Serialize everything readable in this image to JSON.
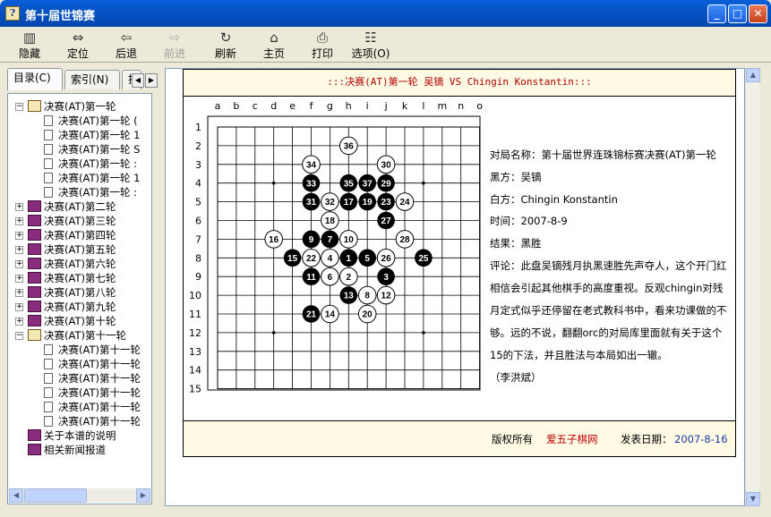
{
  "window": {
    "title": "第十届世锦赛",
    "icon": "help-book-icon",
    "min": "_",
    "max": "□",
    "close": "✕"
  },
  "toolbar": [
    {
      "label": "隐藏",
      "icon": "hide-icon",
      "glyph": "▥",
      "enabled": true
    },
    {
      "label": "定位",
      "icon": "locate-icon",
      "glyph": "⇔",
      "enabled": true
    },
    {
      "label": "后退",
      "icon": "back-arrow-icon",
      "glyph": "⇦",
      "enabled": true
    },
    {
      "label": "前进",
      "icon": "forward-arrow-icon",
      "glyph": "⇨",
      "enabled": false
    },
    {
      "label": "刷新",
      "icon": "refresh-icon",
      "glyph": "↻",
      "enabled": true
    },
    {
      "label": "主页",
      "icon": "home-icon",
      "glyph": "⌂",
      "enabled": true
    },
    {
      "label": "打印",
      "icon": "print-icon",
      "glyph": "⎙",
      "enabled": true
    },
    {
      "label": "选项(O)",
      "icon": "options-icon",
      "glyph": "☷",
      "enabled": true
    }
  ],
  "tabs": [
    {
      "label": "目录(C)"
    },
    {
      "label": "索引(N)"
    },
    {
      "label": "搜"
    }
  ],
  "tree": [
    {
      "label": "决赛(AT)第一轮",
      "open": true,
      "children": [
        "决赛(AT)第一轮 (",
        "决赛(AT)第一轮 1",
        "决赛(AT)第一轮 S",
        "决赛(AT)第一轮 :",
        "决赛(AT)第一轮 1",
        "决赛(AT)第一轮 :"
      ]
    },
    {
      "label": "决赛(AT)第二轮",
      "open": false,
      "children": []
    },
    {
      "label": "决赛(AT)第三轮",
      "open": false,
      "children": []
    },
    {
      "label": "决赛(AT)第四轮",
      "open": false,
      "children": []
    },
    {
      "label": "决赛(AT)第五轮",
      "open": false,
      "children": []
    },
    {
      "label": "决赛(AT)第六轮",
      "open": false,
      "children": []
    },
    {
      "label": "决赛(AT)第七轮",
      "open": false,
      "children": []
    },
    {
      "label": "决赛(AT)第八轮",
      "open": false,
      "children": []
    },
    {
      "label": "决赛(AT)第九轮",
      "open": false,
      "children": []
    },
    {
      "label": "决赛(AT)第十轮",
      "open": false,
      "children": []
    },
    {
      "label": "决赛(AT)第十一轮",
      "open": true,
      "children": [
        "决赛(AT)第十一轮",
        "决赛(AT)第十一轮",
        "决赛(AT)第十一轮",
        "决赛(AT)第十一轮",
        "决赛(AT)第十一轮",
        "决赛(AT)第十一轮"
      ]
    },
    {
      "label": "关于本谱的说明",
      "open": false,
      "leaf": true,
      "children": []
    },
    {
      "label": "相关新闻报道",
      "open": false,
      "leaf": true,
      "children": []
    }
  ],
  "page": {
    "header": ":::决赛(AT)第一轮 吴镝 VS Chingin Konstantin:::",
    "info": {
      "name": "对局名称：第十届世界连珠锦标赛决赛(AT)第一轮",
      "black": "黑方：吴镝",
      "white": "白方：Chingin Konstantin",
      "time": "时间：2007-8-9",
      "result": "结果：黑胜",
      "comment": "评论：此盘吴镝残月执黑速胜先声夺人，这个开门红相信会引起其他棋手的高度重视。反观chingin对残月定式似乎还停留在老式教科书中，看来功课做的不够。远的不说，翻翻orc的对局库里面就有关于这个15的下法，并且胜法与本局如出一辙。",
      "author": "（李洪斌）"
    },
    "footer": {
      "copyright": "版权所有",
      "site": "爱五子棋网",
      "date_label": "发表日期：",
      "date": "2007-8-16"
    }
  },
  "board": {
    "cols": [
      "a",
      "b",
      "c",
      "d",
      "e",
      "f",
      "g",
      "h",
      "i",
      "j",
      "k",
      "l",
      "m",
      "n",
      "o"
    ],
    "rows": [
      "1",
      "2",
      "3",
      "4",
      "5",
      "6",
      "7",
      "8",
      "9",
      "10",
      "11",
      "12",
      "13",
      "14",
      "15"
    ],
    "stones": [
      {
        "n": 1,
        "c": "b",
        "col": "h",
        "row": 8
      },
      {
        "n": 2,
        "c": "w",
        "col": "h",
        "row": 9
      },
      {
        "n": 3,
        "c": "b",
        "col": "j",
        "row": 9
      },
      {
        "n": 4,
        "c": "w",
        "col": "g",
        "row": 8
      },
      {
        "n": 5,
        "c": "b",
        "col": "i",
        "row": 8
      },
      {
        "n": 6,
        "c": "w",
        "col": "g",
        "row": 9
      },
      {
        "n": 7,
        "c": "b",
        "col": "g",
        "row": 7
      },
      {
        "n": 8,
        "c": "w",
        "col": "i",
        "row": 10
      },
      {
        "n": 9,
        "c": "b",
        "col": "f",
        "row": 7
      },
      {
        "n": 10,
        "c": "w",
        "col": "h",
        "row": 7
      },
      {
        "n": 11,
        "c": "b",
        "col": "f",
        "row": 9
      },
      {
        "n": 12,
        "c": "w",
        "col": "j",
        "row": 10
      },
      {
        "n": 13,
        "c": "b",
        "col": "h",
        "row": 10
      },
      {
        "n": 14,
        "c": "w",
        "col": "g",
        "row": 11
      },
      {
        "n": 15,
        "c": "b",
        "col": "e",
        "row": 8
      },
      {
        "n": 16,
        "c": "w",
        "col": "d",
        "row": 7
      },
      {
        "n": 17,
        "c": "b",
        "col": "h",
        "row": 5
      },
      {
        "n": 18,
        "c": "w",
        "col": "g",
        "row": 6
      },
      {
        "n": 19,
        "c": "b",
        "col": "i",
        "row": 5
      },
      {
        "n": 20,
        "c": "w",
        "col": "i",
        "row": 11
      },
      {
        "n": 21,
        "c": "b",
        "col": "f",
        "row": 11
      },
      {
        "n": 22,
        "c": "w",
        "col": "f",
        "row": 8
      },
      {
        "n": 23,
        "c": "b",
        "col": "j",
        "row": 5
      },
      {
        "n": 24,
        "c": "w",
        "col": "k",
        "row": 5
      },
      {
        "n": 25,
        "c": "b",
        "col": "l",
        "row": 8
      },
      {
        "n": 26,
        "c": "w",
        "col": "j",
        "row": 8
      },
      {
        "n": 27,
        "c": "b",
        "col": "j",
        "row": 6
      },
      {
        "n": 28,
        "c": "w",
        "col": "k",
        "row": 7
      },
      {
        "n": 29,
        "c": "b",
        "col": "j",
        "row": 4
      },
      {
        "n": 30,
        "c": "w",
        "col": "j",
        "row": 3
      },
      {
        "n": 31,
        "c": "b",
        "col": "f",
        "row": 5
      },
      {
        "n": 32,
        "c": "w",
        "col": "g",
        "row": 5
      },
      {
        "n": 33,
        "c": "b",
        "col": "f",
        "row": 4
      },
      {
        "n": 34,
        "c": "w",
        "col": "f",
        "row": 3
      },
      {
        "n": 35,
        "c": "b",
        "col": "h",
        "row": 4
      },
      {
        "n": 36,
        "c": "w",
        "col": "h",
        "row": 2
      },
      {
        "n": 37,
        "c": "b",
        "col": "i",
        "row": 4
      }
    ]
  }
}
